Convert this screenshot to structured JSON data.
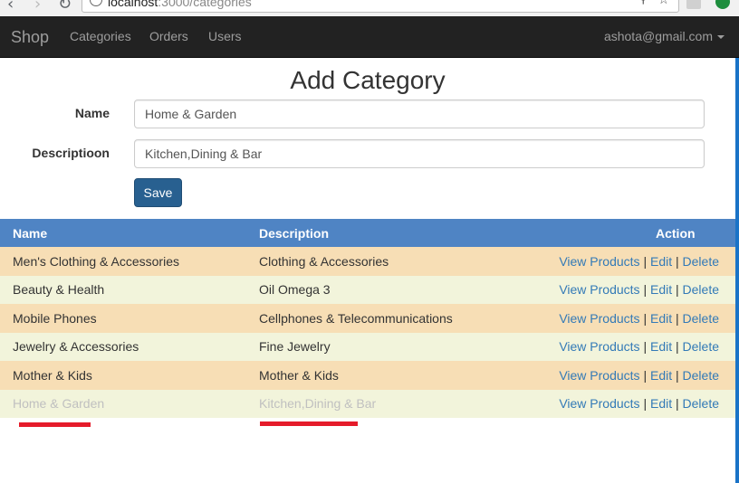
{
  "browser": {
    "url_host": "localhost",
    "url_path": ":3000/categories"
  },
  "navbar": {
    "brand": "Shop",
    "links": [
      "Categories",
      "Orders",
      "Users"
    ],
    "user": "ashota@gmail.com"
  },
  "form": {
    "title": "Add Category",
    "name_label": "Name",
    "name_value": "Home & Garden",
    "description_label": "Descriptioon",
    "description_value": "Kitchen,Dining & Bar",
    "save_label": "Save"
  },
  "table": {
    "headers": [
      "Name",
      "Description",
      "Action"
    ],
    "action_links": [
      "View Products",
      "Edit",
      "Delete"
    ],
    "action_separator": "|",
    "rows": [
      {
        "name": "Men's Clothing & Accessories",
        "description": "Clothing & Accessories"
      },
      {
        "name": "Beauty & Health",
        "description": "Oil Omega 3"
      },
      {
        "name": "Mobile Phones",
        "description": "Cellphones & Telecommunications"
      },
      {
        "name": "Jewelry & Accessories",
        "description": "Fine Jewelry"
      },
      {
        "name": "Mother & Kids",
        "description": "Mother & Kids"
      },
      {
        "name": "Home & Garden",
        "description": "Kitchen,Dining & Bar"
      }
    ]
  },
  "colors": {
    "navbar_bg": "#222222",
    "table_header_bg": "#4f84c4",
    "row_odd_bg": "#f7deb5",
    "row_even_bg": "#f2f4db",
    "link": "#337ab7",
    "save_button_bg": "#286090",
    "annotation_underline": "#e51b2a",
    "faded_text": "#c0c0c0"
  }
}
